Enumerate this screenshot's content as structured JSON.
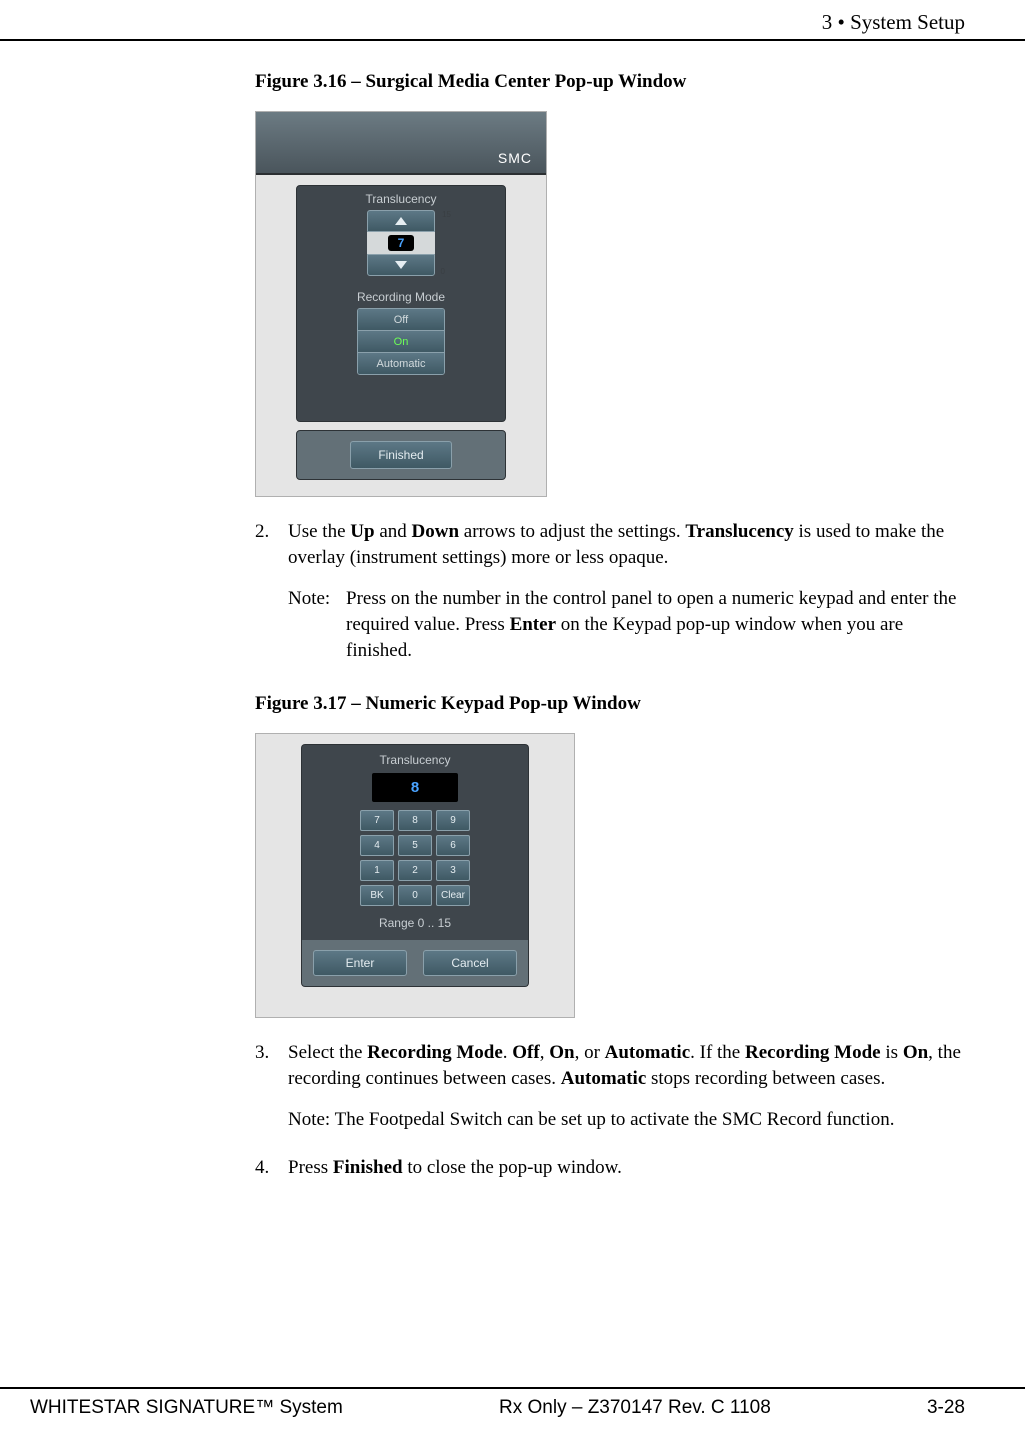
{
  "header": "3  • System Setup",
  "captions": {
    "fig316": "Figure 3.16 – Surgical Media Center Pop-up Window",
    "fig317": "Figure 3.17 – Numeric Keypad Pop-up Window"
  },
  "fig316": {
    "title": "SMC",
    "translucency_label": "Translucency",
    "translucency_value": "7",
    "translucency_max": "15",
    "translucency_min": "0",
    "recording_label": "Recording Mode",
    "options": {
      "off": "Off",
      "on": "On",
      "auto": "Automatic"
    },
    "finished": "Finished"
  },
  "fig317": {
    "title": "Translucency",
    "display": "8",
    "keys": [
      "7",
      "8",
      "9",
      "4",
      "5",
      "6",
      "1",
      "2",
      "3",
      "BK",
      "0",
      "Clear"
    ],
    "range": "Range 0 .. 15",
    "enter": "Enter",
    "cancel": "Cancel"
  },
  "steps": {
    "s2_num": "2.",
    "s2_a": "Use the ",
    "s2_b": "Up",
    "s2_c": " and ",
    "s2_d": "Down",
    "s2_e": " arrows to adjust the settings. ",
    "s2_f": "Translucency",
    "s2_g": " is used to make the overlay (instrument settings) more or less opaque.",
    "note1_label": "Note:",
    "note1_a": "Press on the number in the control panel to open a numeric keypad and enter the required value. Press ",
    "note1_b": "Enter",
    "note1_c": " on the Keypad pop-up window when you are finished.",
    "s3_num": "3.",
    "s3_a": "Select the ",
    "s3_b": "Recording Mode",
    "s3_c": ". ",
    "s3_d": "Off",
    "s3_e": ", ",
    "s3_f": "On",
    "s3_g": ", or ",
    "s3_h": "Automatic",
    "s3_i": ". If the ",
    "s3_j": "Recording Mode",
    "s3_k": " is ",
    "s3_l": "On",
    "s3_m": ", the recording continues between cases. ",
    "s3_n": "Automatic",
    "s3_o": " stops recording between cases.",
    "note2": "Note: The Footpedal Switch can be set up to activate the SMC Record function.",
    "s4_num": "4.",
    "s4_a": "Press ",
    "s4_b": "Finished",
    "s4_c": " to close the pop-up window."
  },
  "footer": {
    "left": "WHITESTAR SIGNATURE™ System",
    "mid": "Rx Only – Z370147 Rev. C 1108",
    "right": "3-28"
  }
}
